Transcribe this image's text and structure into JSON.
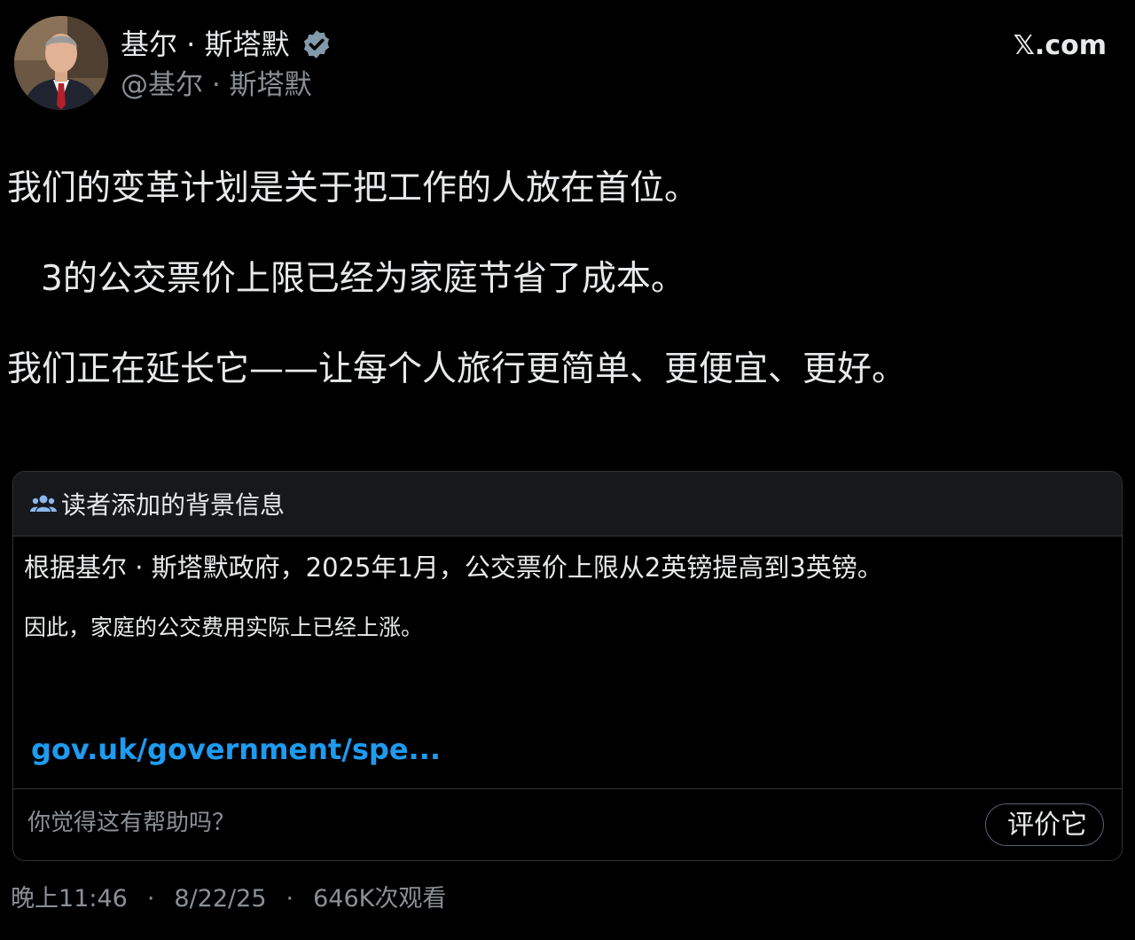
{
  "author": {
    "name": "基尔 · 斯塔默",
    "handle": "@基尔 · 斯塔默",
    "verified": true,
    "avatar_icon": "profile-photo"
  },
  "site": {
    "brand": "𝕏.com"
  },
  "tweet": {
    "lines": [
      "我们的变革计划是关于把工作的人放在首位。",
      "3的公交票价上限已经为家庭节省了成本。",
      "我们正在延长它——让每个人旅行更简单、更便宜、更好。"
    ]
  },
  "community_note": {
    "title": "读者添加的背景信息",
    "icon": "people-icon",
    "paragraph1": "根据基尔 · 斯塔默政府，2025年1月，公交票价上限从2英镑提高到3英镑。",
    "paragraph2": "因此，家庭的公交费用实际上已经上涨。",
    "link_text": "gov.uk/government/spe...",
    "helpful_question": "你觉得这有帮助吗？",
    "rate_button": "评价它"
  },
  "meta": {
    "time": "晚上11:46",
    "date": "8/22/25",
    "views": "646K次观看"
  },
  "colors": {
    "background": "#000000",
    "text": "#e7e9ea",
    "secondary": "#8b9095",
    "link": "#1d9bf0",
    "verified": "#829aab",
    "border": "#2f3336"
  }
}
